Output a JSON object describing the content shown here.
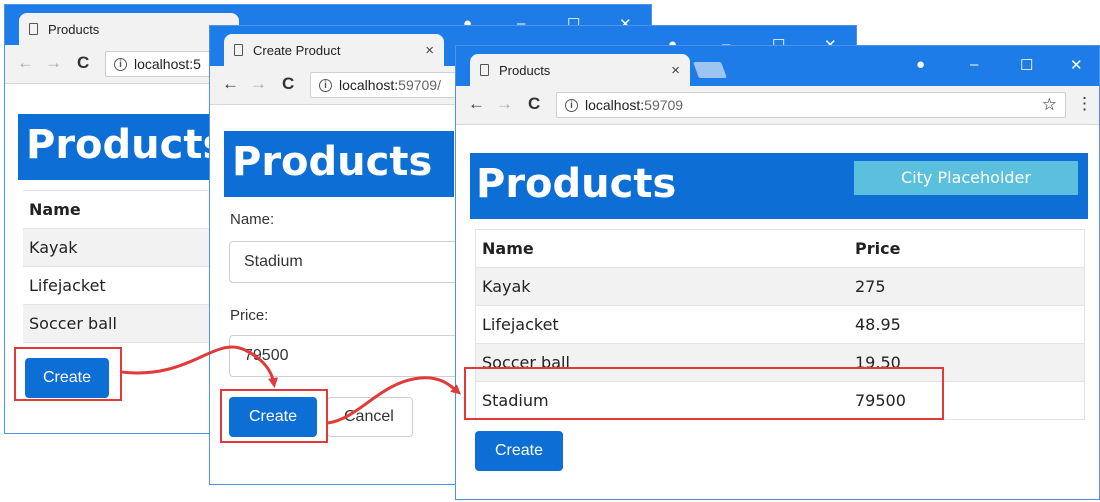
{
  "window1": {
    "tab_title": "Products",
    "address_host": "localhost:5",
    "heading": "Products",
    "columns": [
      "Name"
    ],
    "rows": [
      [
        "Kayak"
      ],
      [
        "Lifejacket"
      ],
      [
        "Soccer ball"
      ]
    ],
    "create_label": "Create"
  },
  "window2": {
    "tab_title": "Create Product",
    "address_host": "localhost:",
    "address_port": "59709/",
    "heading": "Products",
    "name_label": "Name:",
    "name_value": "Stadium",
    "price_label": "Price:",
    "price_value": "79500",
    "create_label": "Create",
    "cancel_label": "Cancel"
  },
  "window3": {
    "tab_title": "Products",
    "address_host": "localhost:",
    "address_port": "59709",
    "heading": "Products",
    "city_placeholder": "City Placeholder",
    "columns": [
      "Name",
      "Price"
    ],
    "rows": [
      [
        "Kayak",
        "275"
      ],
      [
        "Lifejacket",
        "48.95"
      ],
      [
        "Soccer ball",
        "19.50"
      ],
      [
        "Stadium",
        "79500"
      ]
    ],
    "create_label": "Create"
  },
  "icons": {
    "back": "←",
    "forward": "→",
    "reload": "C",
    "info": "i",
    "star": "☆",
    "menu": "⋮",
    "tab_close": "×",
    "minimize": "–",
    "maximize": "☐",
    "close": "✕",
    "account": "●"
  },
  "colors": {
    "chrome_blue": "#1e7ce8",
    "bootstrap_primary": "#0d6fd6",
    "info_button": "#5bc0de",
    "highlight_red": "#e23a3a"
  }
}
